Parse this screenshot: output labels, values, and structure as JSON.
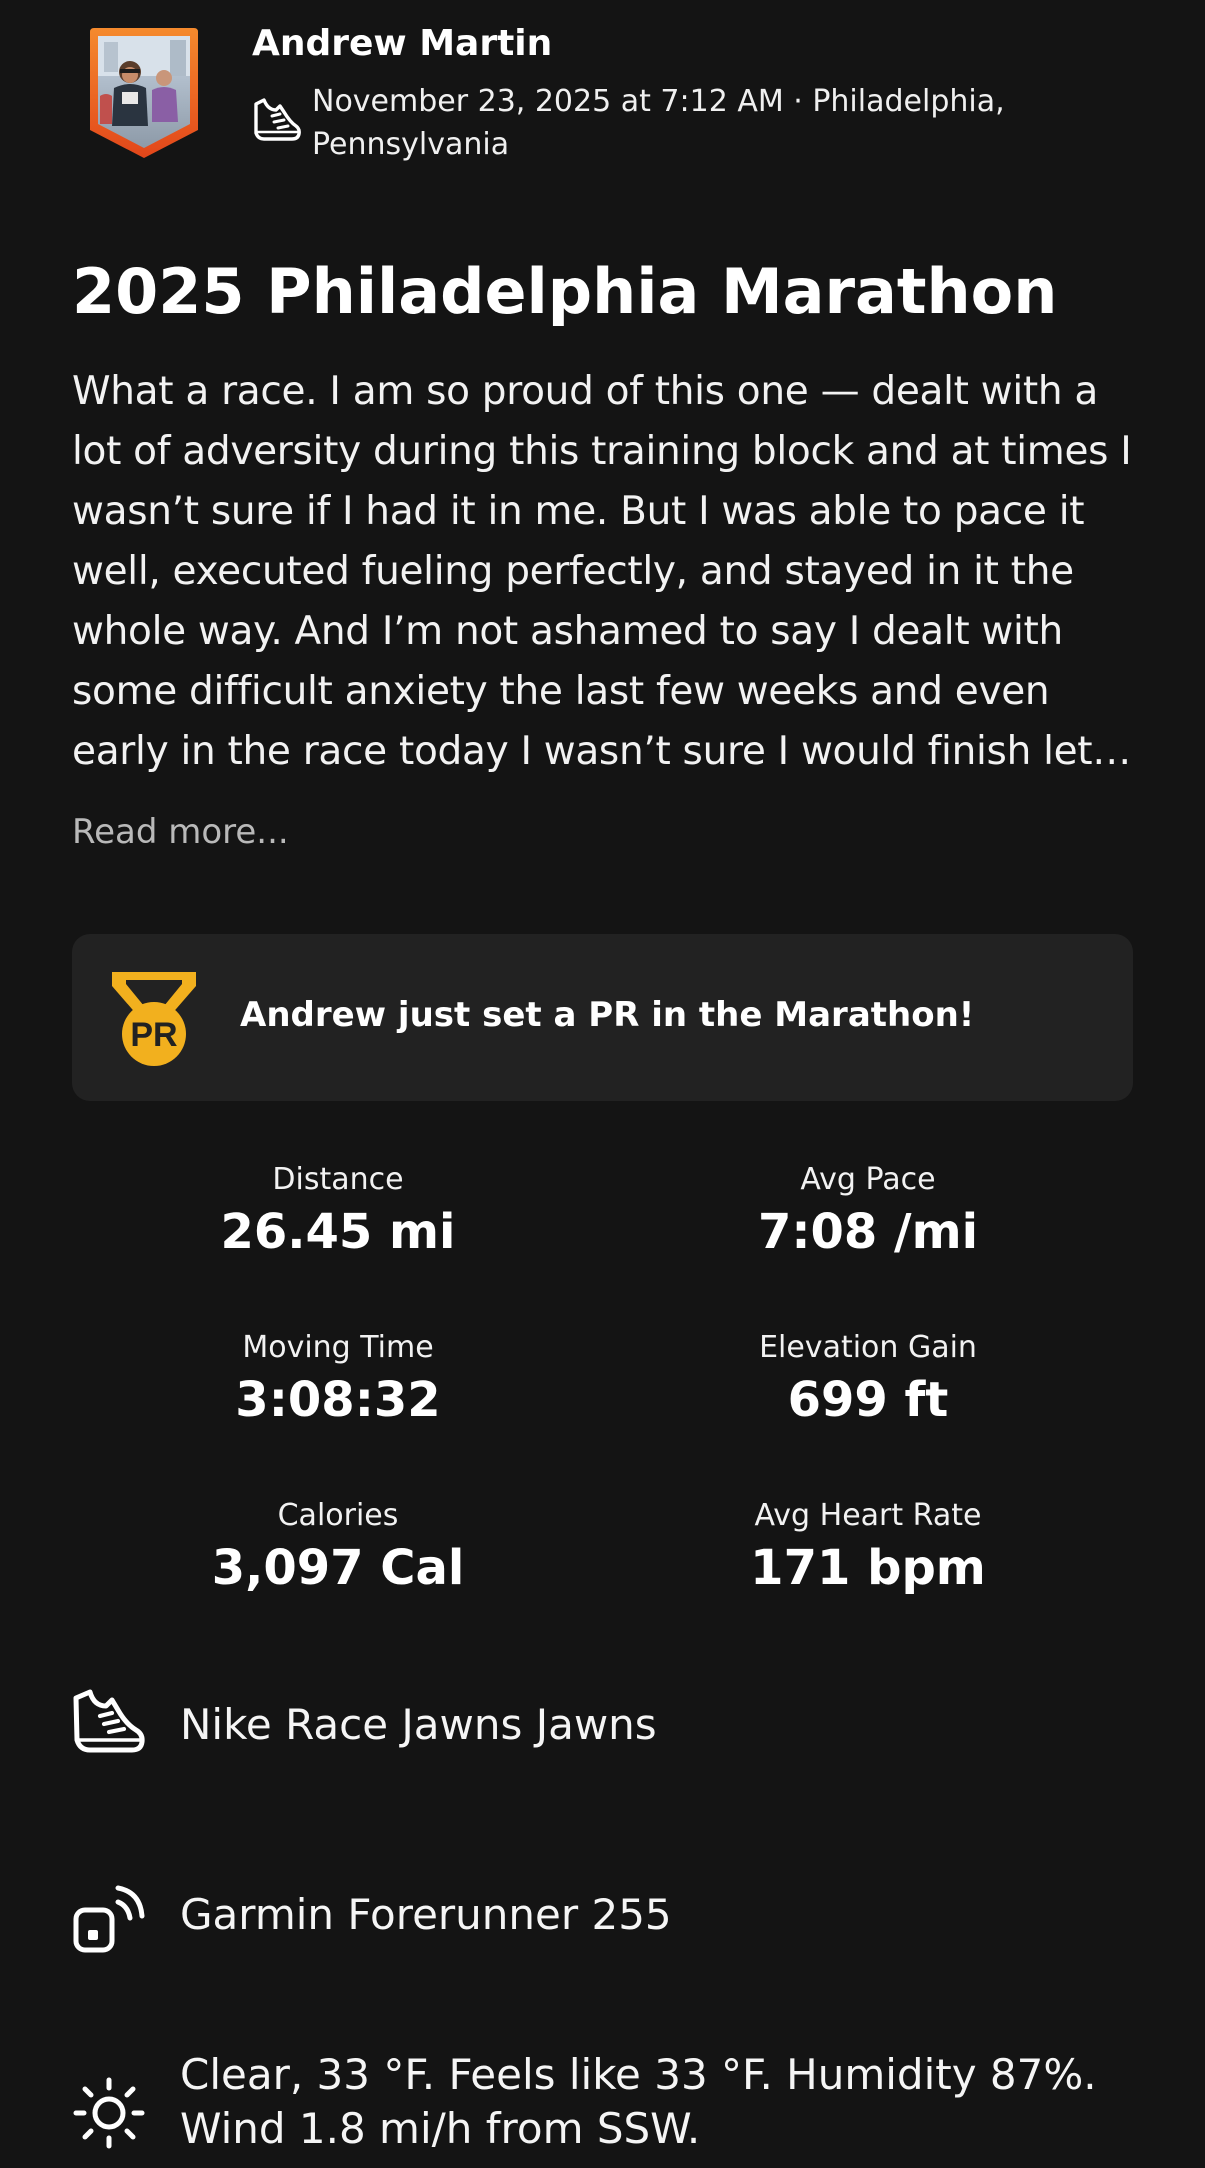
{
  "header": {
    "athlete_name": "Andrew Martin",
    "meta": "November 23, 2025 at 7:12 AM · Philadelphia, Pennsylvania"
  },
  "activity": {
    "title": "2025 Philadelphia Marathon",
    "description": "What a race. I am so proud of this one — dealt with a lot of adversity during this training block and at times I wasn’t sure if I had it in me. But I was able to pace it well, executed fueling perfectly, and stayed in it the whole way. And I’m not ashamed to say I dealt with some difficult anxiety the last few weeks and even early in the race today I wasn’t sure I would finish let…",
    "read_more": "Read more..."
  },
  "achievement": {
    "badge": "PR",
    "text": "Andrew just set a PR in the Marathon!"
  },
  "stats": [
    {
      "label": "Distance",
      "value": "26.45 mi"
    },
    {
      "label": "Avg Pace",
      "value": "7:08 /mi"
    },
    {
      "label": "Moving Time",
      "value": "3:08:32"
    },
    {
      "label": "Elevation Gain",
      "value": "699 ft"
    },
    {
      "label": "Calories",
      "value": "3,097 Cal"
    },
    {
      "label": "Avg Heart Rate",
      "value": "171 bpm"
    }
  ],
  "details": {
    "gear": "Nike Race Jawns Jawns",
    "device": "Garmin Forerunner 255",
    "weather": "Clear, 33 °F. Feels like 33 °F. Humidity 87%. Wind 1.8 mi/h from SSW."
  },
  "icons": {
    "shoe": "shoe-icon",
    "device": "device-icon",
    "weather": "sun-icon",
    "pr": "pr-medal-icon"
  },
  "colors": {
    "background": "#141414",
    "card": "#222222",
    "avatar_frame": "#f26b1d",
    "medal": "#f2b01e",
    "muted_text": "#b9b9b9"
  }
}
